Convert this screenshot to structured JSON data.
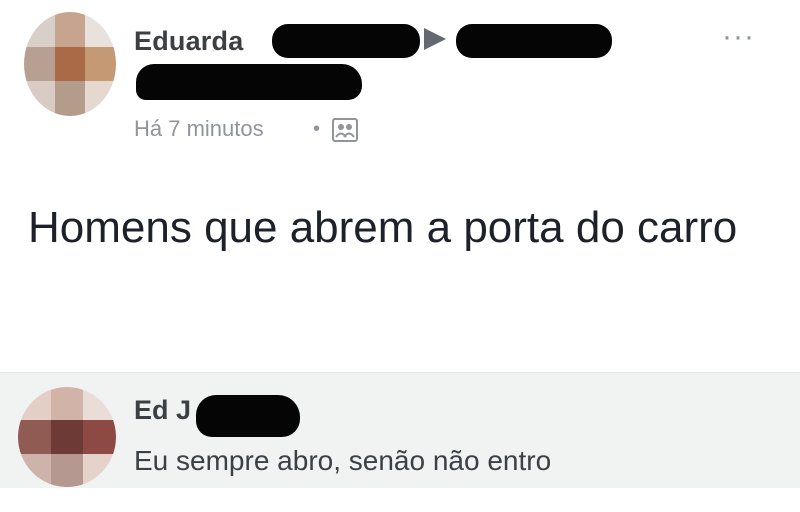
{
  "post": {
    "author": "Eduarda",
    "time": "Há 7 minutos",
    "separator": "•",
    "more_icon": "more-horizontal-icon",
    "privacy_icon": "friends-icon",
    "text": "Homens que abrem a porta do carro"
  },
  "comment": {
    "author": "Ed J",
    "text": "Eu sempre abro, senão não entro"
  },
  "colors": {
    "name": "#3b4045",
    "meta": "#90949c",
    "comment_bg": "#f1f3f2",
    "redaction": "#050505"
  }
}
